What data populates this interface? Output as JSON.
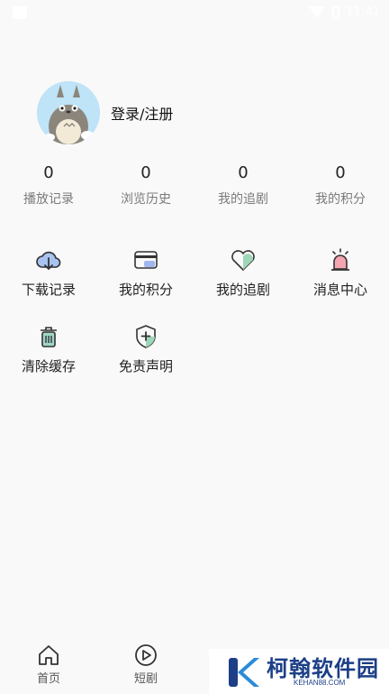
{
  "status_bar": {
    "time": "11:41"
  },
  "profile": {
    "login_label": "登录/注册"
  },
  "stats": [
    {
      "value": "0",
      "label": "播放记录"
    },
    {
      "value": "0",
      "label": "浏览历史"
    },
    {
      "value": "0",
      "label": "我的追剧"
    },
    {
      "value": "0",
      "label": "我的积分"
    }
  ],
  "grid": [
    {
      "label": "下载记录",
      "icon": "cloud-download-icon"
    },
    {
      "label": "我的积分",
      "icon": "card-icon"
    },
    {
      "label": "我的追剧",
      "icon": "heart-icon"
    },
    {
      "label": "消息中心",
      "icon": "alarm-bell-icon"
    },
    {
      "label": "清除缓存",
      "icon": "trash-icon"
    },
    {
      "label": "免责声明",
      "icon": "shield-icon"
    }
  ],
  "bottom_nav": [
    {
      "label": "首页",
      "icon": "home-icon"
    },
    {
      "label": "短剧",
      "icon": "play-icon"
    }
  ],
  "watermark": {
    "title": "柯翰软件园",
    "subtitle": "KEHAN88.COM"
  }
}
